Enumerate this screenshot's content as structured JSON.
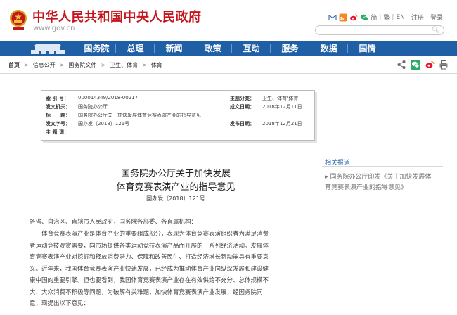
{
  "header": {
    "site_title": "中华人民共和国中央人民政府",
    "site_url": "www.gov.cn",
    "links": [
      "简",
      "繁",
      "EN",
      "注册",
      "登录"
    ]
  },
  "nav": {
    "items": [
      "国务院",
      "总理",
      "新闻",
      "政策",
      "互动",
      "服务",
      "数据",
      "国情"
    ]
  },
  "breadcrumb": {
    "items": [
      "首页",
      "信息公开",
      "国务院文件",
      "卫生、体育",
      "体育"
    ]
  },
  "meta": {
    "index_no_label": "索 引 号：",
    "index_no": "000014349/2018-00217",
    "topic_label": "主题分类：",
    "topic": "卫生、体育\\体育",
    "issuer_label": "发文机关：",
    "issuer": "国务院办公厅",
    "date_label": "成文日期：",
    "date": "2018年12月11日",
    "title_label": "标　　题：",
    "title": "国务院办公厅关于加快发展体育竞赛表演产业的指导意见",
    "doc_no_label": "发文字号：",
    "doc_no": "国办发〔2018〕121号",
    "pub_date_label": "发布日期：",
    "pub_date": "2018年12月21日",
    "subject_label": "主 题 词："
  },
  "related": {
    "title": "相关报道",
    "link": "国务院办公厅印发《关于加快发展体育竞赛表演产业的指导意见》"
  },
  "article": {
    "title_line1": "国务院办公厅关于加快发展",
    "title_line2": "体育竞赛表演产业的指导意见",
    "doc_no": "国办发〔2018〕121号",
    "salutation": "各省、自治区、直辖市人民政府，国务院各部委、各直属机构：",
    "para1_lines": [
      "体育竞赛表演产业是体育产业的重要组成部分，表现为体育竞赛表演组织者为满足消费",
      "者运动竞技观赏需要，向市场提供各类运动竞技表演产品而开展的一系列经济活动。发展体",
      "育竞赛表演产业对挖掘和释放消费潜力、保障和改善民生、打造经济增长新动能具有重要意",
      "义。近年来，我国体育竞赛表演产业快速发展，已经成为推动体育产业向纵深发展和建设健",
      "康中国的重要引擎。但也要看到，我国体育竞赛表演产业存在有效供给不充分、总体规模不",
      "大、大众消费不积极等问题，为破解有关难题，加快体育竞赛表演产业发展，经国务院同",
      "意，现提出以下意见："
    ]
  },
  "colors": {
    "brand_red": "#c4161c",
    "nav_blue": "#1f5fa6"
  },
  "icons": [
    "national-emblem-icon",
    "mail-icon",
    "rss-icon",
    "weibo-icon",
    "wechat-icon",
    "search-icon",
    "share-icon",
    "print-icon"
  ]
}
